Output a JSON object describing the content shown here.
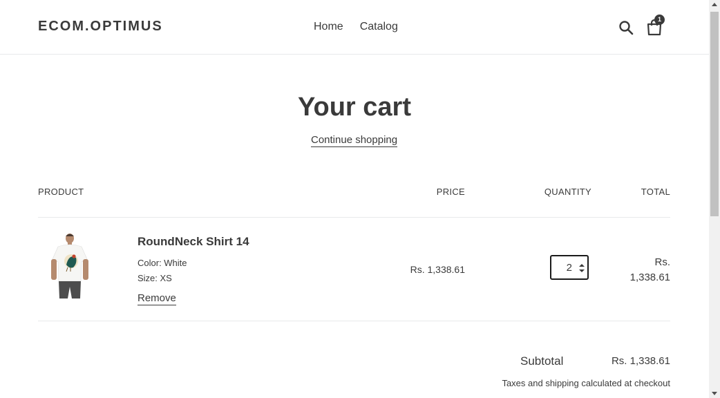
{
  "header": {
    "logo": "ECOM.OPTIMUS",
    "nav": [
      "Home",
      "Catalog"
    ],
    "search_icon": "search-icon",
    "cart_icon": "shopping-bag-icon",
    "cart_count": "1"
  },
  "main": {
    "title": "Your cart",
    "continue_shopping": "Continue shopping"
  },
  "table": {
    "headers": {
      "product": "PRODUCT",
      "price": "PRICE",
      "quantity": "QUANTITY",
      "total": "TOTAL"
    },
    "items": [
      {
        "name": "RoundNeck Shirt 14",
        "color": "Color: White",
        "size": "Size: XS",
        "remove": "Remove",
        "price": "Rs. 1,338.61",
        "quantity": "2",
        "total_line1": "Rs.",
        "total_line2": "1,338.61"
      }
    ]
  },
  "summary": {
    "subtotal_label": "Subtotal",
    "subtotal_value": "Rs. 1,338.61",
    "taxes_note": "Taxes and shipping calculated at checkout"
  },
  "colors": {
    "text": "#3a3a3a",
    "border": "#e8e9eb"
  }
}
